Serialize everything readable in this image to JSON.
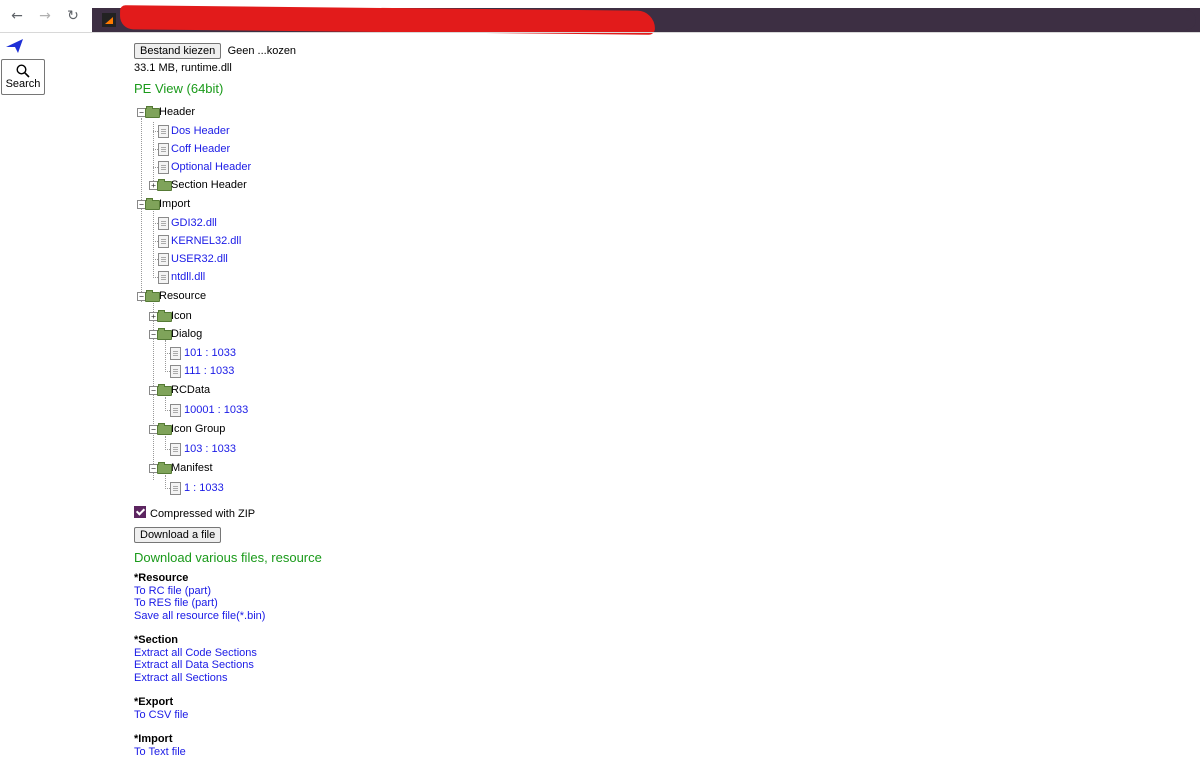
{
  "browser": {
    "back_icon": "arrow-left-icon",
    "forward_icon": "arrow-right-icon",
    "reload_icon": "reload-icon",
    "address_bar_color": "#3d2f43",
    "redaction_color": "#e21b1b"
  },
  "sidebar": {
    "logo_icon": "arrow-logo-icon",
    "search_label": "Search"
  },
  "file": {
    "choose_button": "Bestand kiezen",
    "status": "Geen ...kozen",
    "info": "33.1 MB, runtime.dll"
  },
  "pe": {
    "title": "PE View (64bit)",
    "tree": {
      "header": {
        "label": "Header",
        "children": [
          "Dos Header",
          "Coff Header",
          "Optional Header",
          "Section Header"
        ]
      },
      "import": {
        "label": "Import",
        "children": [
          "GDI32.dll",
          "KERNEL32.dll",
          "USER32.dll",
          "ntdll.dll"
        ]
      },
      "resource": {
        "label": "Resource",
        "icon": "Icon",
        "dialog": {
          "label": "Dialog",
          "children": [
            "101 : 1033",
            "111 : 1033"
          ]
        },
        "rcdata": {
          "label": "RCData",
          "children": [
            "10001 : 1033"
          ]
        },
        "icon_group": {
          "label": "Icon Group",
          "children": [
            "103 : 1033"
          ]
        },
        "manifest": {
          "label": "Manifest",
          "children": [
            "1 : 1033"
          ]
        }
      }
    }
  },
  "options": {
    "compressed_label": "Compressed with ZIP",
    "compressed_checked": true,
    "download_button": "Download a file"
  },
  "downloads": {
    "title": "Download various files, resource",
    "resource": {
      "heading": "*Resource",
      "links": [
        "To RC file (part)",
        "To RES file (part)",
        "Save all resource file(*.bin)"
      ]
    },
    "section": {
      "heading": "*Section",
      "links": [
        "Extract all Code Sections",
        "Extract all Data Sections",
        "Extract all Sections"
      ]
    },
    "export": {
      "heading": "*Export",
      "links": [
        "To CSV file"
      ]
    },
    "import": {
      "heading": "*Import",
      "links": [
        "To Text file"
      ]
    }
  }
}
